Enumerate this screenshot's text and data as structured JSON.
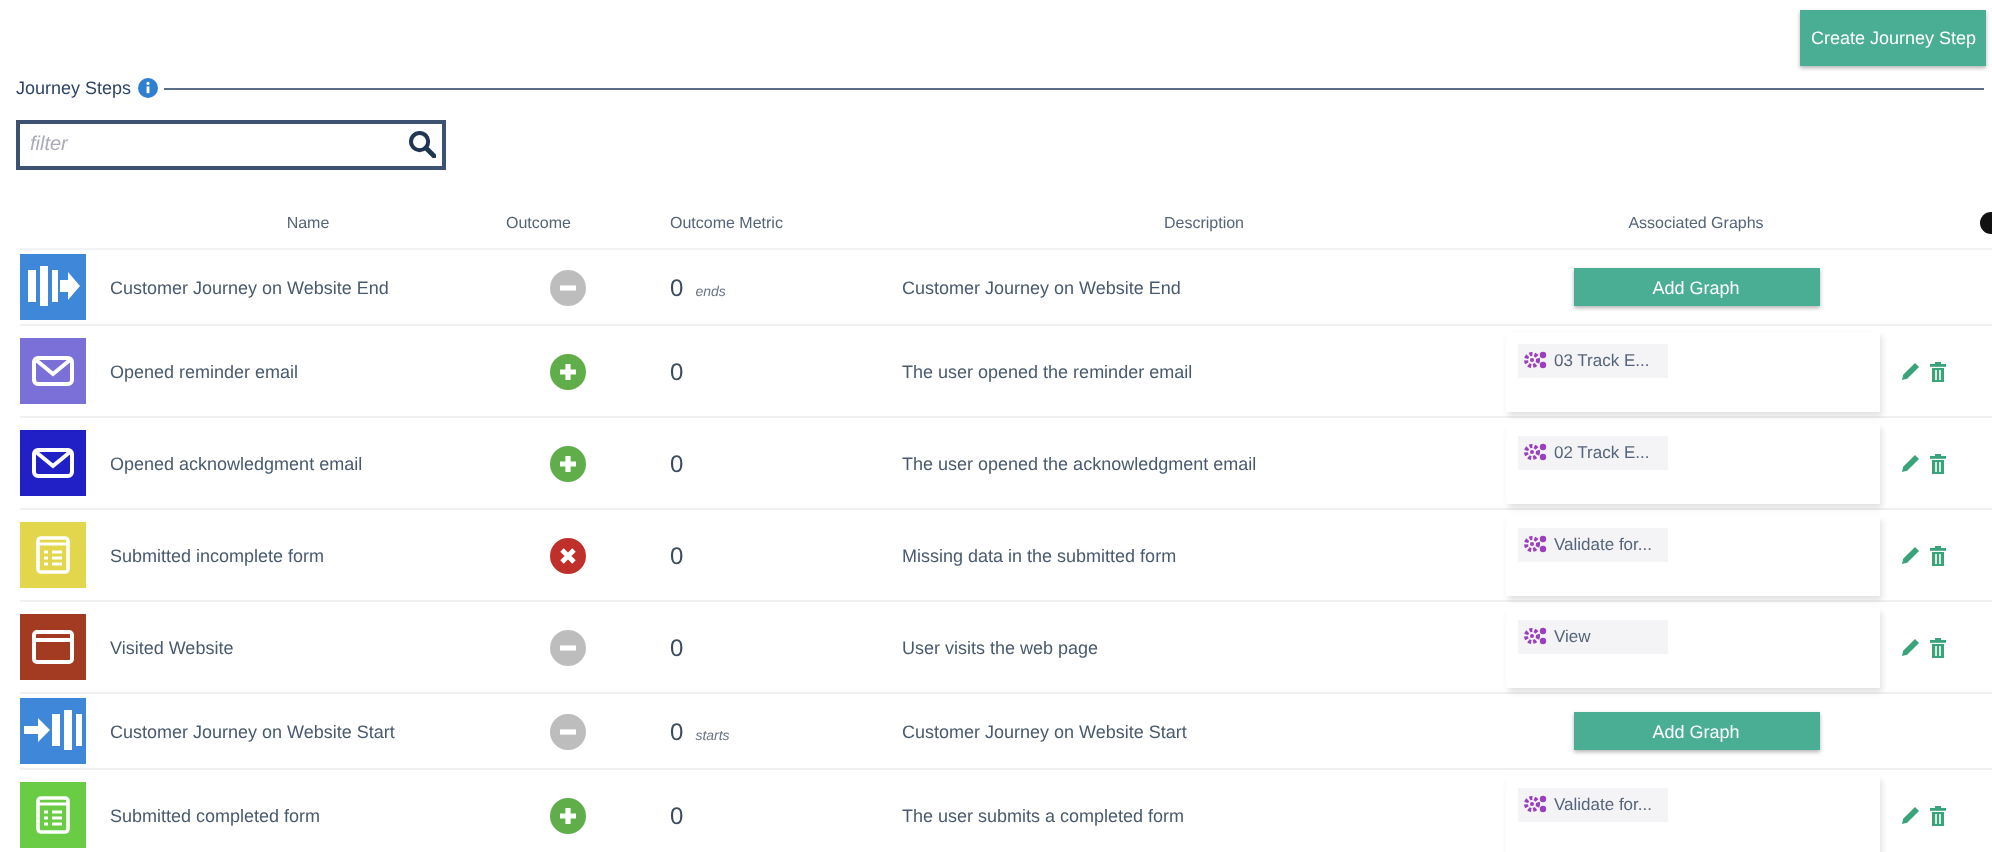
{
  "create_button": "Create Journey Step",
  "section": {
    "title": "Journey Steps"
  },
  "filter": {
    "placeholder": "filter"
  },
  "table": {
    "columns": [
      "Name",
      "Outcome",
      "Outcome Metric",
      "Description",
      "Associated Graphs"
    ],
    "rows": [
      {
        "kind": "end",
        "color": "#3f87d9",
        "name": "Customer Journey on Website End",
        "outcome": {
          "kind": "neutral"
        },
        "metric": "0",
        "metric_note": "ends",
        "description": "Customer Journey on Website End",
        "graph": {
          "kind": "add",
          "label": "Add Graph"
        }
      },
      {
        "kind": "email",
        "color": "#7b6fd8",
        "name": "Opened reminder email",
        "outcome": {
          "kind": "positive"
        },
        "metric": "0",
        "description": "The user opened the reminder email",
        "graph": {
          "kind": "chip",
          "label": "03 Track E..."
        }
      },
      {
        "kind": "email",
        "color": "#2020c6",
        "name": "Opened acknowledgment email",
        "outcome": {
          "kind": "positive"
        },
        "metric": "0",
        "description": "The user opened the acknowledgment email",
        "graph": {
          "kind": "chip",
          "label": "02 Track E..."
        }
      },
      {
        "kind": "form",
        "color": "#e2d64c",
        "name": "Submitted incomplete form",
        "outcome": {
          "kind": "negative"
        },
        "metric": "0",
        "description": "Missing data in the submitted form",
        "graph": {
          "kind": "chip",
          "label": "Validate for..."
        }
      },
      {
        "kind": "browser",
        "color": "#a33b22",
        "name": "Visited Website",
        "outcome": {
          "kind": "neutral"
        },
        "metric": "0",
        "description": "User visits the web page",
        "graph": {
          "kind": "chip",
          "label": "View"
        }
      },
      {
        "kind": "start",
        "color": "#3f87d9",
        "name": "Customer Journey on Website Start",
        "outcome": {
          "kind": "neutral"
        },
        "metric": "0",
        "metric_note": "starts",
        "description": "Customer Journey on Website Start",
        "graph": {
          "kind": "add",
          "label": "Add Graph"
        }
      },
      {
        "kind": "form",
        "color": "#6acb44",
        "name": "Submitted completed form",
        "outcome": {
          "kind": "positive"
        },
        "metric": "0",
        "description": "The user submits a completed form",
        "graph": {
          "kind": "chip",
          "label": "Validate for..."
        }
      }
    ]
  }
}
